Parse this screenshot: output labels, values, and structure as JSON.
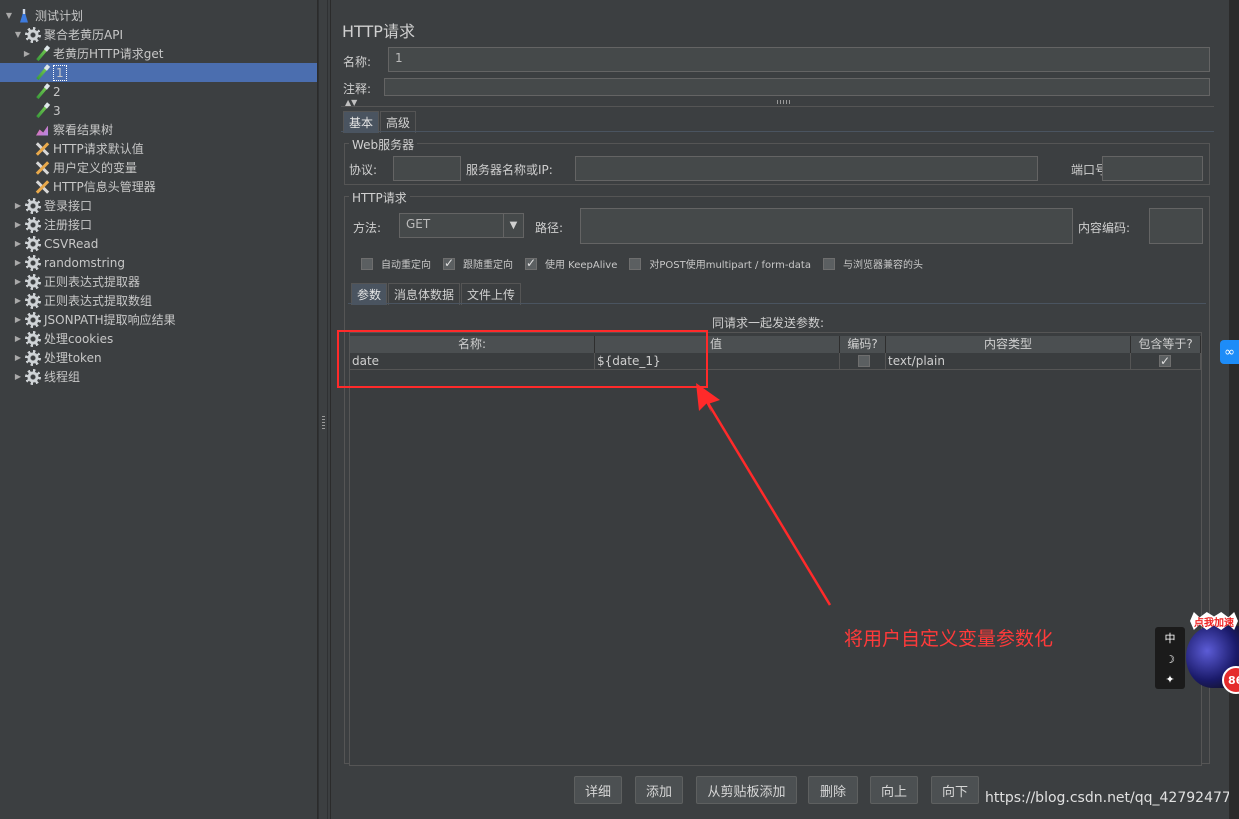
{
  "tree": {
    "items": [
      {
        "label": "测试计划",
        "icon": "flask-icon",
        "expanded": true
      },
      {
        "label": "聚合老黄历API",
        "icon": "gear-icon",
        "expanded": true
      },
      {
        "label": "老黄历HTTP请求get",
        "icon": "pipette-icon",
        "expanded": false
      },
      {
        "label": "1",
        "icon": "pipette-icon",
        "selected": true
      },
      {
        "label": "2",
        "icon": "pipette-icon"
      },
      {
        "label": "3",
        "icon": "pipette-icon"
      },
      {
        "label": "察看结果树",
        "icon": "chart-icon"
      },
      {
        "label": "HTTP请求默认值",
        "icon": "wrench-icon"
      },
      {
        "label": "用户定义的变量",
        "icon": "wrench-icon"
      },
      {
        "label": "HTTP信息头管理器",
        "icon": "wrench-icon"
      },
      {
        "label": "登录接口",
        "icon": "gear-icon"
      },
      {
        "label": "注册接口",
        "icon": "gear-icon"
      },
      {
        "label": "CSVRead",
        "icon": "gear-icon"
      },
      {
        "label": "randomstring",
        "icon": "gear-icon"
      },
      {
        "label": "正则表达式提取器",
        "icon": "gear-icon"
      },
      {
        "label": "正则表达式提取数组",
        "icon": "gear-icon"
      },
      {
        "label": "JSONPATH提取响应结果",
        "icon": "gear-icon"
      },
      {
        "label": "处理cookies",
        "icon": "gear-icon"
      },
      {
        "label": "处理token",
        "icon": "gear-icon"
      },
      {
        "label": "线程组",
        "icon": "gear-icon"
      }
    ]
  },
  "panel": {
    "title": "HTTP请求",
    "name_label": "名称:",
    "name_value": "1",
    "comment_label": "注释:",
    "comment_value": "",
    "tabs": [
      "基本",
      "高级"
    ]
  },
  "web_server": {
    "group_title": "Web服务器",
    "protocol_label": "协议:",
    "protocol_value": "",
    "server_label": "服务器名称或IP:",
    "server_value": "",
    "port_label": "端口号:",
    "port_value": ""
  },
  "http_request": {
    "group_title": "HTTP请求",
    "method_label": "方法:",
    "method_value": "GET",
    "path_label": "路径:",
    "path_value": "",
    "encoding_label": "内容编码:",
    "encoding_value": "",
    "options": [
      {
        "label": "自动重定向",
        "checked": false
      },
      {
        "label": "跟随重定向",
        "checked": true
      },
      {
        "label": "使用 KeepAlive",
        "checked": true
      },
      {
        "label": "对POST使用multipart / form-data",
        "checked": false
      },
      {
        "label": "与浏览器兼容的头",
        "checked": false
      }
    ],
    "sub_tabs": [
      "参数",
      "消息体数据",
      "文件上传"
    ]
  },
  "params": {
    "caption": "同请求一起发送参数:",
    "columns": [
      "名称:",
      "值",
      "编码?",
      "内容类型",
      "包含等于?"
    ],
    "rows": [
      {
        "name": "date",
        "value": "${date_1}",
        "encode": false,
        "content_type": "text/plain",
        "include_equals": true
      }
    ],
    "buttons": [
      "详细",
      "添加",
      "从剪贴板添加",
      "删除",
      "向上",
      "向下"
    ]
  },
  "annotation": {
    "note": "将用户自定义变量参数化",
    "color": "#ff2a2a"
  },
  "watermark": "https://blog.csdn.net/qq_42792477",
  "widgets": {
    "ime_char": "中",
    "speed_label": "点我加速",
    "speed_count": "86"
  }
}
